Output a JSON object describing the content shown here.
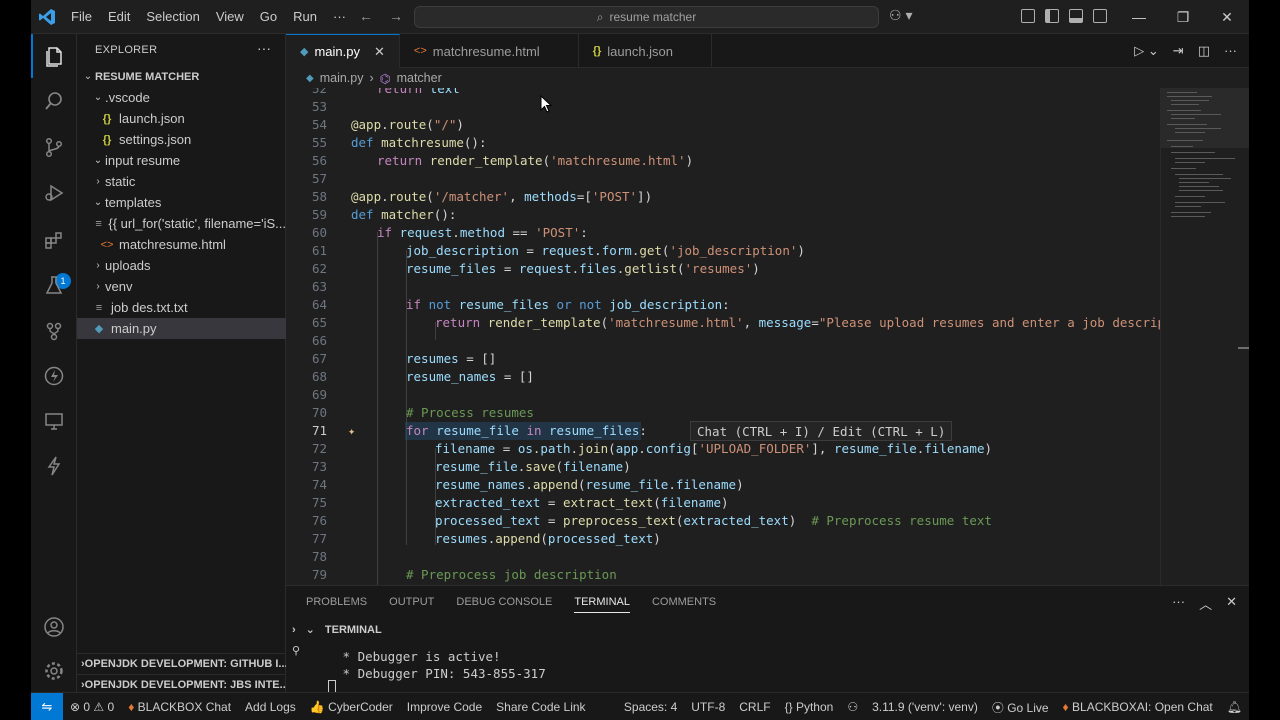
{
  "titlebar": {
    "menu": [
      "File",
      "Edit",
      "Selection",
      "View",
      "Go",
      "Run",
      "···"
    ],
    "search_placeholder": "resume matcher"
  },
  "explorer": {
    "title": "EXPLORER",
    "root": "RESUME MATCHER",
    "items": [
      {
        "label": ".vscode",
        "type": "folder",
        "open": true,
        "depth": 1
      },
      {
        "label": "launch.json",
        "type": "json",
        "depth": 2
      },
      {
        "label": "settings.json",
        "type": "json",
        "depth": 2
      },
      {
        "label": "input resume",
        "type": "folder",
        "open": true,
        "depth": 1
      },
      {
        "label": "static",
        "type": "folder",
        "open": false,
        "depth": 1
      },
      {
        "label": "templates",
        "type": "folder",
        "open": true,
        "depth": 1
      },
      {
        "label": "{{ url_for('static', filename='iS...",
        "type": "file",
        "depth": 2
      },
      {
        "label": "matchresume.html",
        "type": "html",
        "depth": 2
      },
      {
        "label": "uploads",
        "type": "folder",
        "open": false,
        "depth": 1
      },
      {
        "label": "venv",
        "type": "folder",
        "open": false,
        "depth": 1
      },
      {
        "label": "job des.txt.txt",
        "type": "txt",
        "depth": 1
      },
      {
        "label": "main.py",
        "type": "py",
        "depth": 1,
        "selected": true
      }
    ],
    "bottom_sections": [
      "OPENJDK DEVELOPMENT: GITHUB I...",
      "OPENJDK DEVELOPMENT: JBS INTE..."
    ]
  },
  "tabs": [
    {
      "label": "main.py",
      "icon": "python-icon",
      "active": true
    },
    {
      "label": "matchresume.html",
      "icon": "html-icon",
      "active": false
    },
    {
      "label": "launch.json",
      "icon": "json-icon",
      "active": false
    }
  ],
  "breadcrumb": [
    "main.py",
    "matcher"
  ],
  "line_numbers": [
    "52",
    "53",
    "54",
    "55",
    "56",
    "57",
    "58",
    "59",
    "60",
    "61",
    "62",
    "63",
    "64",
    "65",
    "66",
    "67",
    "68",
    "69",
    "70",
    "71",
    "72",
    "73",
    "74",
    "75",
    "76",
    "77",
    "78",
    "79"
  ],
  "inline_hint": "Chat (CTRL + I) / Edit (CTRL + L)",
  "panel": {
    "tabs": [
      "PROBLEMS",
      "OUTPUT",
      "DEBUG CONSOLE",
      "TERMINAL",
      "COMMENTS"
    ],
    "active_tab": "TERMINAL",
    "terminal_title": "TERMINAL",
    "lines": [
      " * Debugger is active!",
      " * Debugger PIN: 543-855-317"
    ]
  },
  "statusbar": {
    "errors": "0",
    "warnings": "0",
    "left_items": [
      "BLACKBOX Chat",
      "Add Logs",
      "CyberCoder",
      "Improve Code",
      "Share Code Link"
    ],
    "spaces": "Spaces: 4",
    "encoding": "UTF-8",
    "eol": "CRLF",
    "language": "Python",
    "interpreter": "3.11.9 ('venv': venv)",
    "golive": "Go Live",
    "blackbox": "BLACKBOXAI: Open Chat"
  },
  "colors": {
    "accent": "#0078d4",
    "editor_bg": "#1f1f1f",
    "sidebar_bg": "#181818"
  }
}
